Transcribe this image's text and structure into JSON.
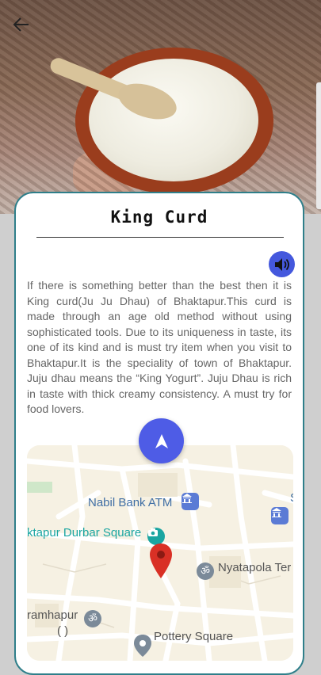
{
  "header": {
    "back_icon": "arrow-left-icon",
    "hero_image": "king-curd-clay-bowl-photo"
  },
  "card": {
    "title": "King Curd",
    "speaker_icon": "speaker-volume-icon",
    "description": "If there is something better than the best then it is King curd(Ju Ju Dhau) of Bhaktapur.This curd is made through an age old method without using sophisticated tools. Due to its uniqueness in taste, its one of its kind and is must try item when you visit to Bhaktapur.It is the speciality of town of Bhaktapur. Juju dhau means the “King Yogurt”. Juju Dhau is rich in taste with thick creamy consistency. A must try for food lovers."
  },
  "map": {
    "nav_icon": "navigation-arrow-icon",
    "labels": {
      "nabil_bank": "Nabil Bank ATM",
      "durbar_square": "ktapur Durbar Square",
      "nyatapola": "Nyatapola Ter",
      "bramhapur": "ramhapur",
      "bramhapur_sub": "(    )",
      "pottery_square": "Pottery Square",
      "edge_s": "S"
    },
    "colors": {
      "accent": "#4e5ce6",
      "pin": "#d93025",
      "poi_blue": "#5b7bd5",
      "poi_grey": "#7b8a99",
      "poi_teal": "#1aa5a1",
      "card_border": "#2f7f8a"
    }
  }
}
